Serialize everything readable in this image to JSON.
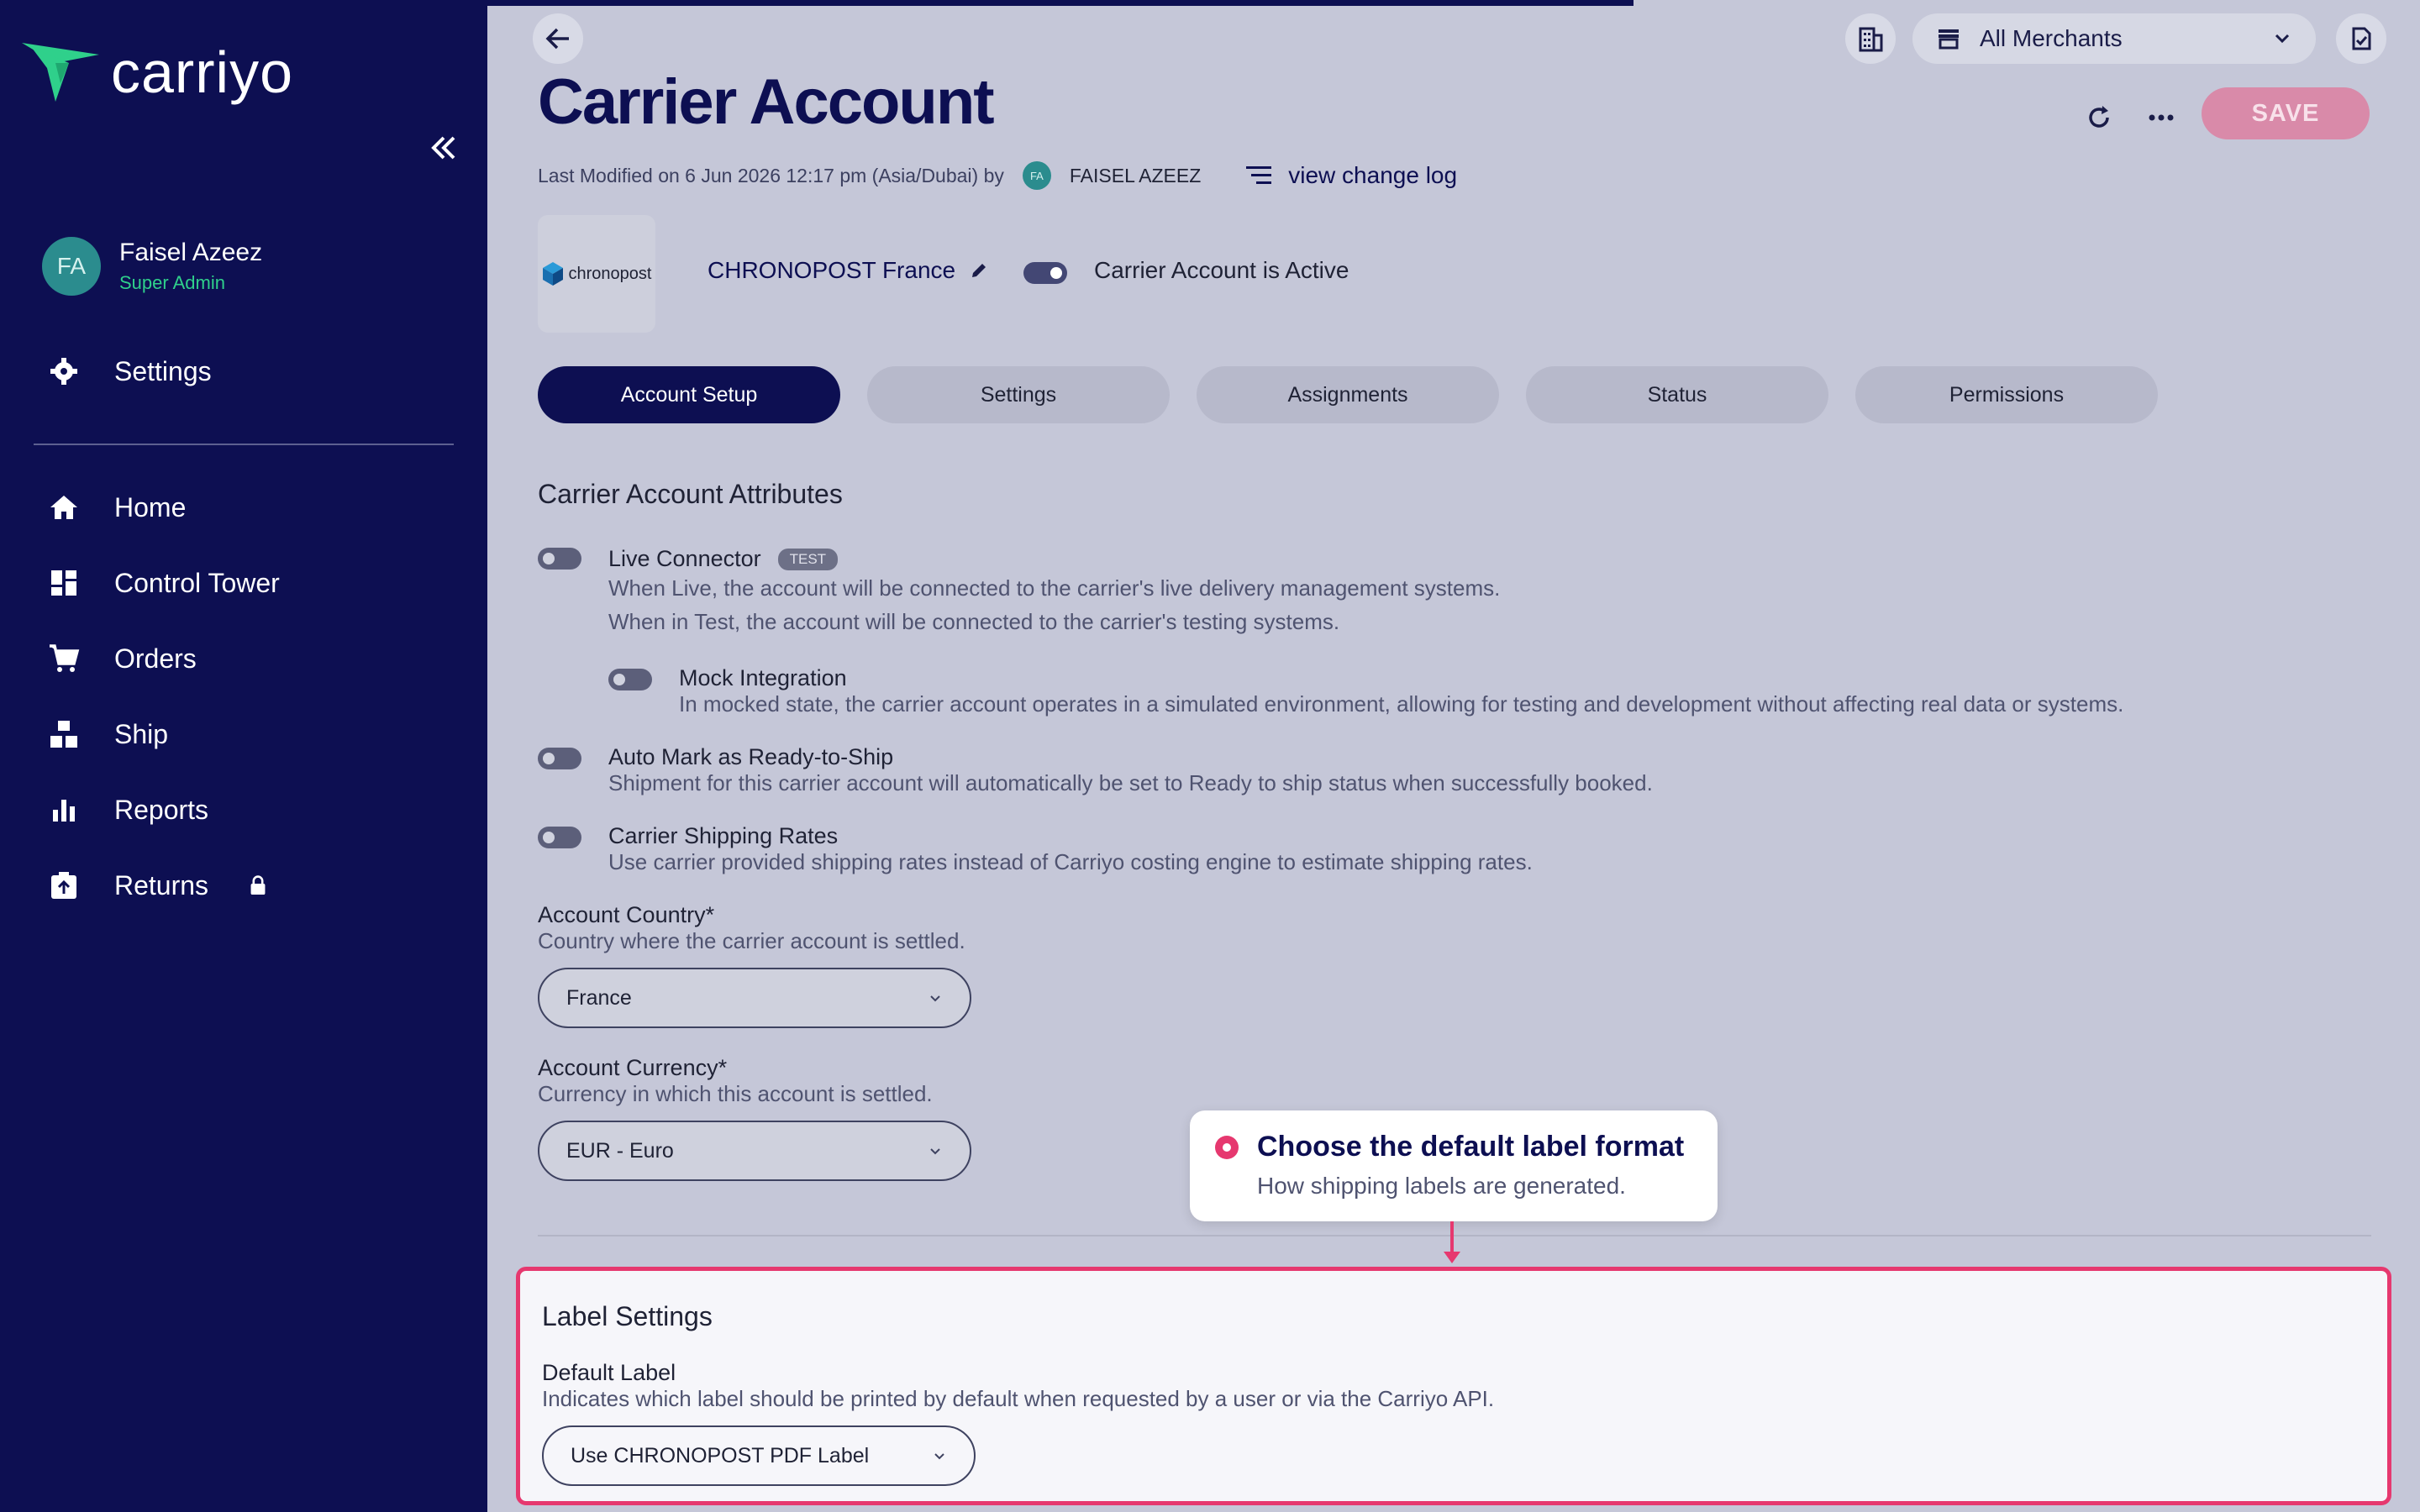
{
  "sidebar": {
    "brand": "carriyo",
    "user": {
      "initials": "FA",
      "name": "Faisel Azeez",
      "role": "Super Admin"
    },
    "settings_label": "Settings",
    "items": [
      {
        "label": "Home",
        "icon": "home-icon"
      },
      {
        "label": "Control Tower",
        "icon": "dashboard-icon"
      },
      {
        "label": "Orders",
        "icon": "cart-icon"
      },
      {
        "label": "Ship",
        "icon": "boxes-icon"
      },
      {
        "label": "Reports",
        "icon": "bar-chart-icon"
      },
      {
        "label": "Returns",
        "icon": "return-box-icon"
      }
    ]
  },
  "header": {
    "merchant_select": "All Merchants",
    "save_label": "SAVE"
  },
  "page": {
    "title": "Carrier Account",
    "last_modified": "Last Modified on 6 Jun 2026 12:17 pm (Asia/Dubai) by",
    "modifier_initials": "FA",
    "modifier_name": "FAISEL AZEEZ",
    "change_log": "view change log"
  },
  "carrier": {
    "logo_text": "chronopost",
    "name": "CHRONOPOST France",
    "active_label": "Carrier Account is Active",
    "active": true
  },
  "tabs": [
    "Account Setup",
    "Settings",
    "Assignments",
    "Status",
    "Permissions"
  ],
  "active_tab": "Account Setup",
  "attributes": {
    "heading": "Carrier Account Attributes",
    "live_connector": {
      "title": "Live Connector",
      "badge": "TEST",
      "desc1": "When Live, the account will be connected to the carrier's live delivery management systems.",
      "desc2": "When in Test, the account will be connected to the carrier's testing systems."
    },
    "mock": {
      "title": "Mock Integration",
      "desc": "In mocked state, the carrier account operates in a simulated environment, allowing for testing and development without affecting real data or systems."
    },
    "auto_mark": {
      "title": "Auto Mark as Ready-to-Ship",
      "desc": "Shipment for this carrier account will automatically be set to Ready to ship status when successfully booked."
    },
    "shipping_rates": {
      "title": "Carrier Shipping Rates",
      "desc": "Use carrier provided shipping rates instead of Carriyo costing engine to estimate shipping rates."
    },
    "country": {
      "title": "Account Country*",
      "desc": "Country where the carrier account is settled.",
      "value": "France"
    },
    "currency": {
      "title": "Account Currency*",
      "desc": "Currency in which this account is settled.",
      "value": "EUR - Euro"
    }
  },
  "tooltip": {
    "title": "Choose the default label format",
    "subtitle": "How shipping labels are generated."
  },
  "label_settings": {
    "heading": "Label Settings",
    "default_label_title": "Default Label",
    "default_label_desc": "Indicates which label should be printed by default when requested by a user or via the Carriyo API.",
    "value": "Use CHRONOPOST PDF Label"
  },
  "colors": {
    "sidebar_bg": "#0d0f52",
    "accent_pink": "#e6386f",
    "teal": "#2b8c8e"
  }
}
